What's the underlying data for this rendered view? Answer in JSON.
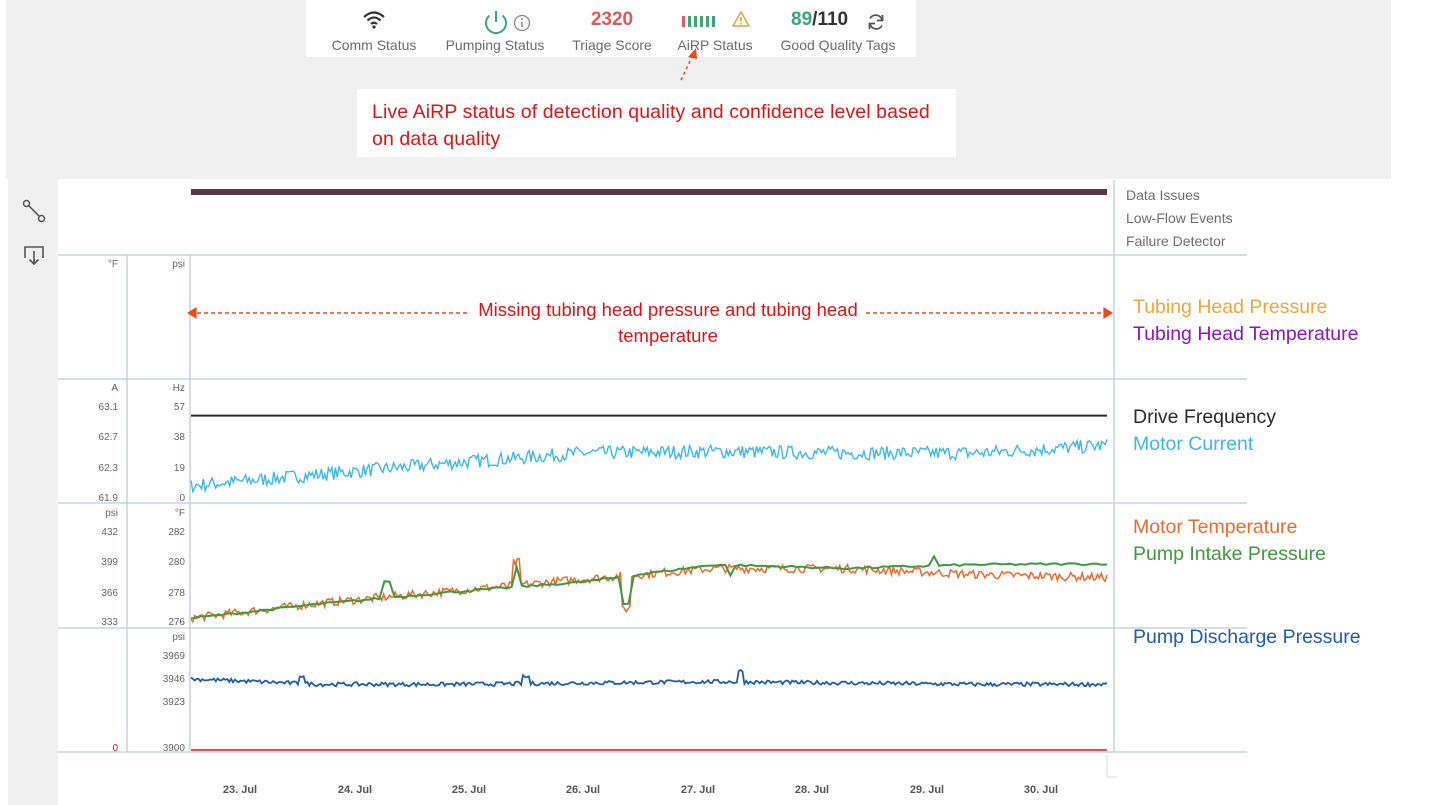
{
  "status_bar": {
    "comm_status": {
      "label": "Comm Status",
      "icon": "wifi-icon"
    },
    "pumping_status": {
      "label": "Pumping Status",
      "icon": "power-icon",
      "info_icon": "info-icon",
      "color": "#3aa776"
    },
    "triage_score": {
      "value": "2320",
      "label": "Triage Score",
      "color": "#e05b5b"
    },
    "airp_status": {
      "label": "AiRP Status",
      "bars_icon": "signal-bars-icon",
      "warning_icon": "warning-icon",
      "warning_color": "#e8a33c"
    },
    "good_quality_tags": {
      "good": "89",
      "total": "/110",
      "label": "Good Quality Tags",
      "good_color": "#3aa776",
      "refresh_icon": "refresh-icon"
    }
  },
  "callout": {
    "text": "Live AiRP status of detection quality and confidence level based on data quality"
  },
  "annotation_missing": "Missing tubing head pressure and tubing head temperature",
  "toolbar": {
    "path_icon": "path-icon",
    "download_icon": "download-icon"
  },
  "event_tracks": {
    "labels": [
      "Data Issues",
      "Low-Flow Events",
      "Failure Detector"
    ]
  },
  "legends": [
    {
      "text": "Tubing Head Pressure",
      "color": "#f0a63c"
    },
    {
      "text": "Tubing Head Temperature",
      "color": "#8b14c8"
    },
    {
      "text": "Drive Frequency",
      "color": "#2b2b2b"
    },
    {
      "text": "Motor Current",
      "color": "#3db8ec"
    },
    {
      "text": "Motor Temperature",
      "color": "#ee6a2b"
    },
    {
      "text": "Pump Intake Pressure",
      "color": "#3f9a3f"
    },
    {
      "text": "Pump Discharge Pressure",
      "color": "#1f5fa8"
    }
  ],
  "chart_data": [
    {
      "type": "line",
      "panel": "tubing-head",
      "axes": [
        {
          "unit": "°F",
          "ticks": []
        },
        {
          "unit": "psi",
          "ticks": []
        }
      ],
      "series": [
        {
          "name": "Tubing Head Pressure",
          "values": []
        },
        {
          "name": "Tubing Head Temperature",
          "values": []
        }
      ]
    },
    {
      "type": "line",
      "panel": "drive",
      "x": [
        "23. Jul",
        "24. Jul",
        "25. Jul",
        "26. Jul",
        "27. Jul",
        "28. Jul",
        "29. Jul",
        "30. Jul"
      ],
      "axes": [
        {
          "unit": "A",
          "ticks": [
            "63.1",
            "62.7",
            "62.3",
            "61.9"
          ],
          "ylim": [
            61.9,
            63.1
          ]
        },
        {
          "unit": "Hz",
          "ticks": [
            "57",
            "38",
            "19",
            "0"
          ],
          "ylim": [
            0,
            57
          ]
        }
      ],
      "series": [
        {
          "name": "Drive Frequency",
          "axis": 1,
          "values": [
            51,
            51,
            51,
            51,
            51,
            51,
            51,
            51
          ]
        },
        {
          "name": "Motor Current",
          "axis": 0,
          "values": [
            62.05,
            62.2,
            62.35,
            62.48,
            62.5,
            62.48,
            62.48,
            62.58
          ]
        }
      ]
    },
    {
      "type": "line",
      "panel": "motor-pump",
      "x": [
        "23. Jul",
        "24. Jul",
        "25. Jul",
        "26. Jul",
        "27. Jul",
        "28. Jul",
        "29. Jul",
        "30. Jul"
      ],
      "axes": [
        {
          "unit": "psi",
          "ticks": [
            "432",
            "399",
            "366",
            "333"
          ],
          "ylim": [
            333,
            432
          ]
        },
        {
          "unit": "°F",
          "ticks": [
            "282",
            "280",
            "278",
            "276"
          ],
          "ylim": [
            276,
            282
          ]
        }
      ],
      "series": [
        {
          "name": "Motor Temperature",
          "axis": 1,
          "values": [
            276.2,
            277.2,
            278.0,
            278.8,
            279.5,
            279.5,
            279.1,
            278.9
          ]
        },
        {
          "name": "Pump Intake Pressure",
          "axis": 0,
          "values": [
            336,
            352,
            365,
            376,
            395,
            391,
            395,
            396
          ]
        }
      ]
    },
    {
      "type": "line",
      "panel": "discharge",
      "x": [
        "23. Jul",
        "24. Jul",
        "25. Jul",
        "26. Jul",
        "27. Jul",
        "28. Jul",
        "29. Jul",
        "30. Jul"
      ],
      "axes": [
        {
          "unit": "",
          "ticks": [
            "0"
          ]
        },
        {
          "unit": "psi",
          "ticks": [
            "3969",
            "3946",
            "3923",
            "3900"
          ],
          "ylim": [
            3900,
            3969
          ]
        }
      ],
      "series": [
        {
          "name": "Pump Discharge Pressure",
          "axis": 1,
          "values": [
            3951,
            3947,
            3947,
            3948,
            3949,
            3948,
            3947,
            3947
          ]
        }
      ]
    }
  ]
}
